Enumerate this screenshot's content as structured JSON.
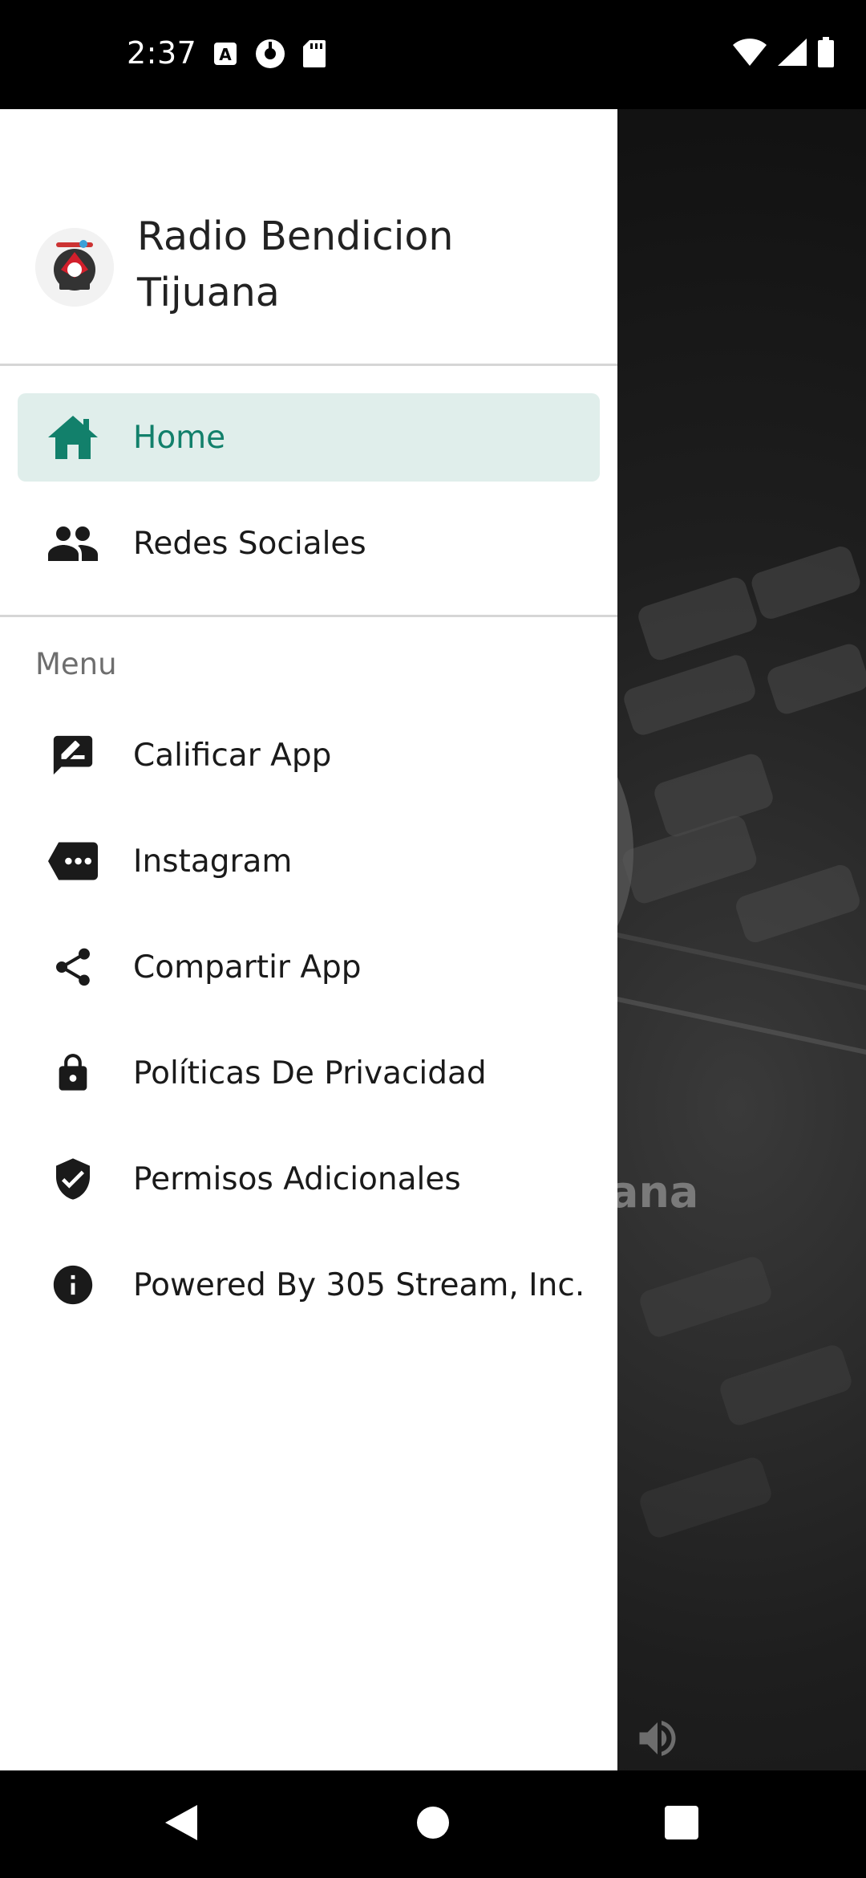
{
  "status_bar": {
    "time": "2:37",
    "left_icons": [
      "autofill-icon",
      "timer-icon",
      "sd-card-icon"
    ],
    "right_icons": [
      "wifi-icon",
      "signal-icon",
      "battery-icon"
    ]
  },
  "drawer": {
    "title": "Radio Bendicion Tijuana",
    "primary_items": [
      {
        "label": "Home",
        "icon": "home-icon",
        "active": true
      },
      {
        "label": "Redes Sociales",
        "icon": "people-icon",
        "active": false
      }
    ],
    "section_label": "Menu",
    "menu_items": [
      {
        "label": "Calificar App",
        "icon": "rate-review-icon"
      },
      {
        "label": "Instagram",
        "icon": "message-icon"
      },
      {
        "label": "Compartir App",
        "icon": "share-icon"
      },
      {
        "label": "Políticas De Privacidad",
        "icon": "lock-icon"
      },
      {
        "label": "Permisos Adicionales",
        "icon": "shield-check-icon"
      },
      {
        "label": "Powered By 305 Stream, Inc.",
        "icon": "info-icon"
      }
    ]
  },
  "background": {
    "title_fragment": "ana"
  },
  "colors": {
    "accent": "#12806b",
    "active_bg": "#e0eeeb",
    "scrim": "#000000"
  }
}
